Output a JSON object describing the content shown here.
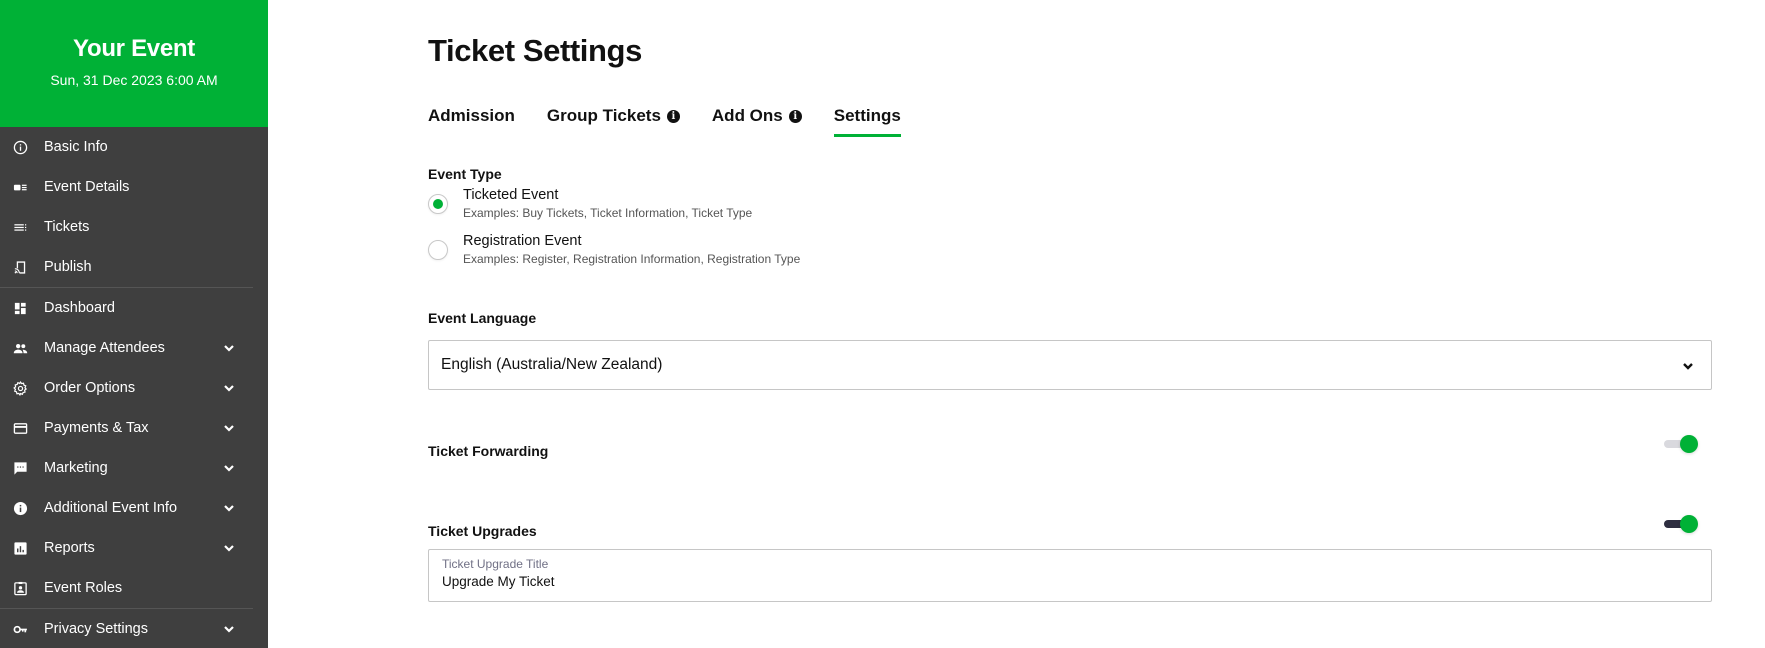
{
  "sidebar": {
    "event_title": "Your Event",
    "event_date": "Sun, 31 Dec 2023 6:00 AM",
    "header_color": "#00b136",
    "items": [
      {
        "label": "Basic Info",
        "icon": "info-outline-icon",
        "expandable": false
      },
      {
        "label": "Event Details",
        "icon": "event-details-icon",
        "expandable": false
      },
      {
        "label": "Tickets",
        "icon": "tickets-list-icon",
        "expandable": false
      },
      {
        "label": "Publish",
        "icon": "cast-publish-icon",
        "expandable": false
      },
      {
        "label": "Dashboard",
        "icon": "dashboard-icon",
        "expandable": false
      },
      {
        "label": "Manage Attendees",
        "icon": "people-icon",
        "expandable": true
      },
      {
        "label": "Order Options",
        "icon": "gear-icon",
        "expandable": true
      },
      {
        "label": "Payments & Tax",
        "icon": "credit-card-icon",
        "expandable": true
      },
      {
        "label": "Marketing",
        "icon": "message-icon",
        "expandable": true
      },
      {
        "label": "Additional Event Info",
        "icon": "info-filled-icon",
        "expandable": true
      },
      {
        "label": "Reports",
        "icon": "bar-chart-icon",
        "expandable": true
      },
      {
        "label": "Event Roles",
        "icon": "badge-icon",
        "expandable": false
      },
      {
        "label": "Privacy Settings",
        "icon": "key-icon",
        "expandable": true
      }
    ]
  },
  "main": {
    "title": "Ticket Settings",
    "tabs": [
      {
        "label": "Admission",
        "info": false,
        "active": false
      },
      {
        "label": "Group Tickets",
        "info": true,
        "active": false
      },
      {
        "label": "Add Ons",
        "info": true,
        "active": false
      },
      {
        "label": "Settings",
        "info": false,
        "active": true
      }
    ],
    "info_glyph": "i",
    "event_type": {
      "label": "Event Type",
      "options": [
        {
          "title": "Ticketed Event",
          "subtitle": "Examples: Buy Tickets, Ticket Information, Ticket Type",
          "selected": true
        },
        {
          "title": "Registration Event",
          "subtitle": "Examples: Register, Registration Information, Registration Type",
          "selected": false
        }
      ]
    },
    "event_language": {
      "label": "Event Language",
      "selected": "English (Australia/New Zealand)"
    },
    "ticket_forwarding": {
      "label": "Ticket Forwarding",
      "enabled": true,
      "track_color": "#d9d9de"
    },
    "ticket_upgrades": {
      "label": "Ticket Upgrades",
      "enabled": true,
      "track_color": "#2e2e40",
      "title_field_label": "Ticket Upgrade Title",
      "title_field_value": "Upgrade My Ticket"
    },
    "accent_color": "#00b136"
  }
}
